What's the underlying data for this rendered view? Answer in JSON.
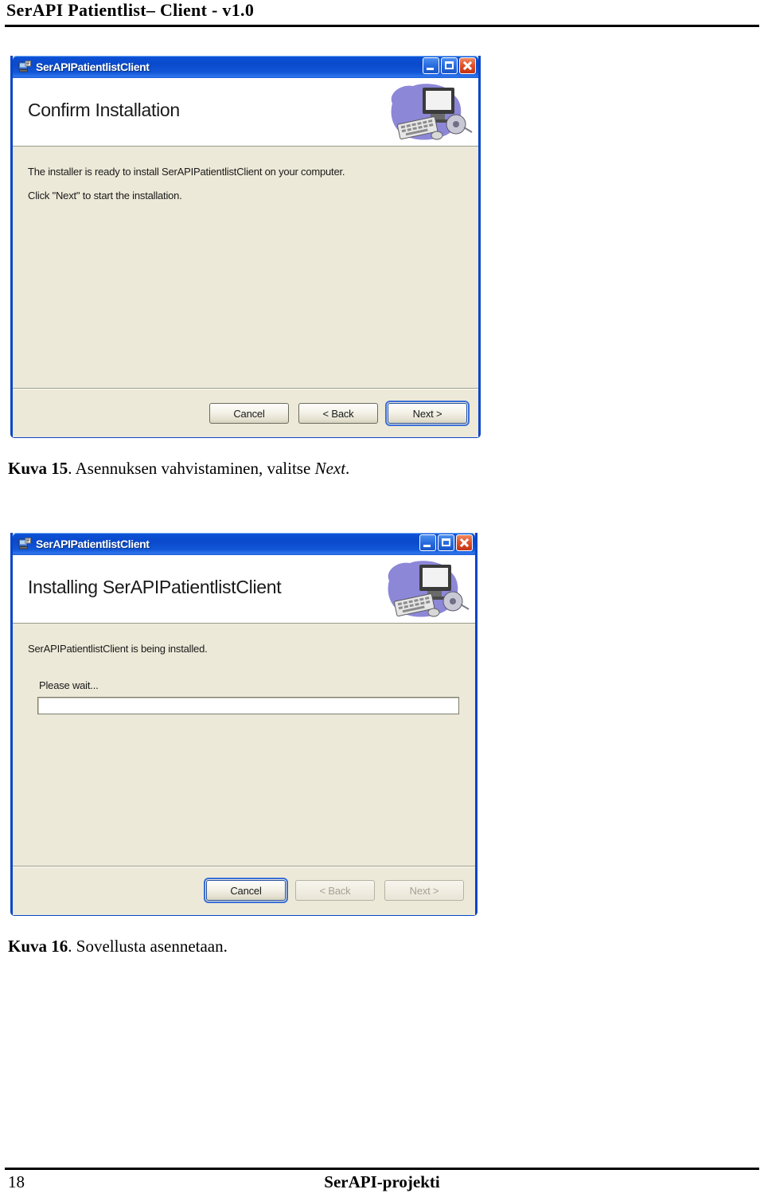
{
  "page": {
    "header_title": "SerAPI Patientlist– Client -  v1.0",
    "page_number": "18",
    "footer_center": "SerAPI-projekti"
  },
  "figures": [
    {
      "caption_bold": "Kuva 15",
      "caption_rest": ". Asennuksen vahvistaminen, valitse ",
      "caption_italic": "Next",
      "caption_end": ".",
      "dialog": {
        "title": "SerAPIPatientlistClient",
        "title_icon": "installer-package-icon",
        "window_buttons": {
          "minimize": "minimize-icon",
          "maximize": "maximize-icon",
          "close": "close-icon"
        },
        "banner_title": "Confirm Installation",
        "banner_art": "computer-keyboard-cd-clipart",
        "body_lines": [
          "The installer is ready to install SerAPIPatientlistClient on your computer.",
          "Click \"Next\" to start the installation."
        ],
        "buttons": [
          {
            "label": "Cancel",
            "state": "enabled"
          },
          {
            "label": "< Back",
            "state": "enabled"
          },
          {
            "label": "Next >",
            "state": "focused"
          }
        ]
      }
    },
    {
      "caption_bold": "Kuva 16",
      "caption_rest": ". Sovellusta asennetaan.",
      "caption_italic": "",
      "caption_end": "",
      "dialog": {
        "title": "SerAPIPatientlistClient",
        "title_icon": "installer-package-icon",
        "window_buttons": {
          "minimize": "minimize-icon",
          "maximize": "maximize-icon",
          "close": "close-icon"
        },
        "banner_title": "Installing SerAPIPatientlistClient",
        "banner_art": "computer-keyboard-cd-clipart",
        "body_lines": [
          "SerAPIPatientlistClient is being installed."
        ],
        "progress_label": "Please wait...",
        "progress_percent": 0,
        "buttons": [
          {
            "label": "Cancel",
            "state": "focused"
          },
          {
            "label": "< Back",
            "state": "disabled"
          },
          {
            "label": "Next >",
            "state": "disabled"
          }
        ]
      }
    }
  ],
  "colors": {
    "titlebar_blue": "#0A4ACB",
    "window_border": "#0A46C8",
    "dialog_body": "#ECE9D8",
    "close_red": "#E2542A"
  }
}
